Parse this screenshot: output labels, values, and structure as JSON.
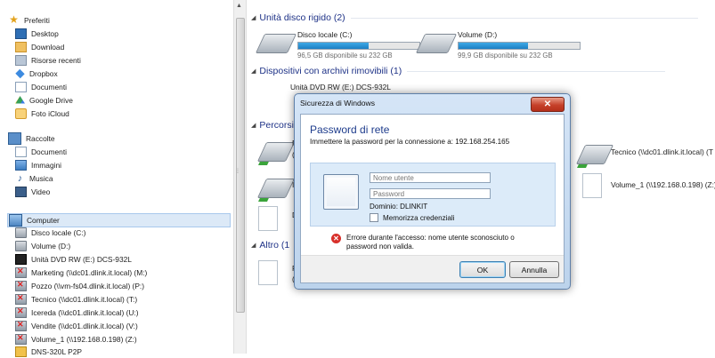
{
  "nav": {
    "favorites_label": "Preferiti",
    "favorites": [
      "Desktop",
      "Download",
      "Risorse recenti",
      "Dropbox",
      "Documenti",
      "Google Drive",
      "Foto iCloud"
    ],
    "libraries_label": "Raccolte",
    "libraries": [
      "Documenti",
      "Immagini",
      "Musica",
      "Video"
    ],
    "computer_label": "Computer",
    "computer": [
      "Disco locale (C:)",
      "Volume (D:)",
      "Unità DVD RW (E:) DCS-932L",
      "Marketing (\\\\dc01.dlink.it.local) (M:)",
      "Pozzo (\\\\vm-fs04.dlink.it.local) (P:)",
      "Tecnico (\\\\dc01.dlink.it.local) (T:)",
      "Icereda (\\\\dc01.dlink.it.local) (U:)",
      "Vendite (\\\\dc01.dlink.it.local) (V:)",
      "Volume_1 (\\\\192.168.0.198) (Z:)",
      "DNS-320L P2P"
    ]
  },
  "main": {
    "hdd_group": "Unità disco rigido (2)",
    "drives": [
      {
        "name": "Disco locale (C:)",
        "free": "96,5 GB disponibile su 232 GB",
        "used_fraction": 0.58
      },
      {
        "name": "Volume (D:)",
        "free": "99,9 GB disponibile su 232 GB",
        "used_fraction": 0.57
      }
    ],
    "removable_group": "Dispositivi con archivi rimovibili (1)",
    "dvd_name": "Unità DVD RW (E:) DCS-932L",
    "network_group_partial": "Percorsi",
    "other_group_partial": "Altro (1",
    "right_items": [
      "Tecnico (\\\\dc01.dlink.it.local) (T",
      "Volume_1 (\\\\192.168.0.198) (Z:)"
    ],
    "partial_letters": [
      "N",
      "(",
      "I",
      "D",
      "F",
      "(",
      "("
    ]
  },
  "dialog": {
    "title": "Sicurezza di Windows",
    "close_glyph": "✕",
    "heading": "Password di rete",
    "description": "Immettere la password per la connessione a: 192.168.254.165",
    "username_placeholder": "Nome utente",
    "password_placeholder": "Password",
    "domain": "Dominio: DLINKIT",
    "remember": "Memorizza credenziali",
    "error": "Errore durante l'accesso: nome utente sconosciuto o password non valida.",
    "ok": "OK",
    "cancel": "Annulla"
  },
  "colors": {
    "accent": "#1e3287",
    "error": "#d8302a",
    "bar": "#1d7fc4"
  }
}
